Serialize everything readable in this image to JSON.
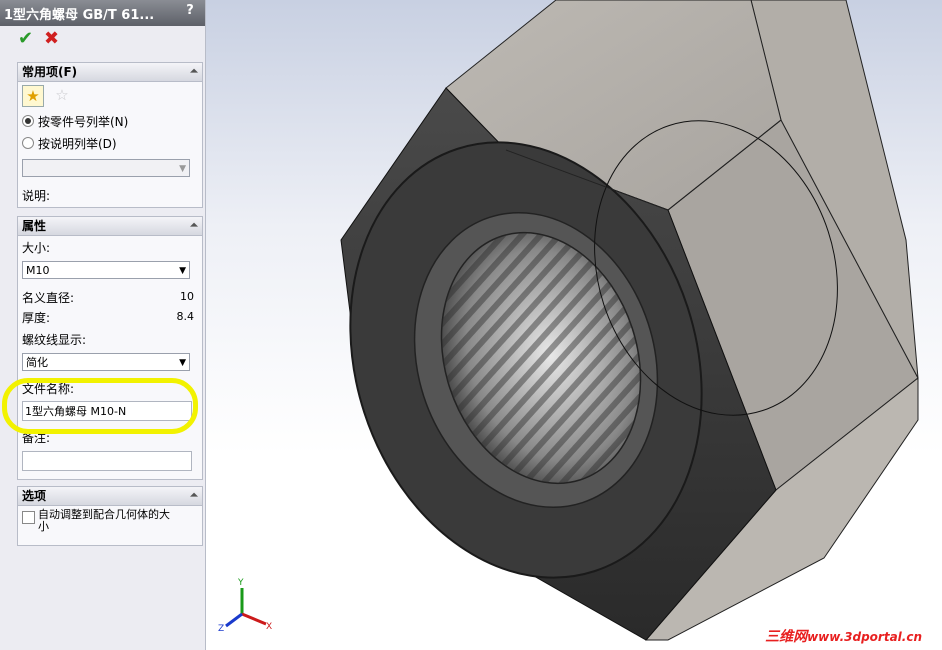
{
  "window": {
    "title": "1型六角螺母 GB/T 61...",
    "help_label": "?"
  },
  "actions": {
    "confirm_icon": "check-icon",
    "cancel_icon": "x-icon"
  },
  "common": {
    "header": "常用项(F)",
    "add_favorite_icon": "star-add-icon",
    "remove_favorite_icon": "star-remove-icon",
    "radio_by_part": "按零件号列举(N)",
    "radio_by_desc": "按说明列举(D)",
    "description_label": "说明:"
  },
  "properties": {
    "header": "属性",
    "size_label": "大小:",
    "size_value": "M10",
    "nominal_diameter_label": "名义直径:",
    "nominal_diameter_value": "10",
    "thickness_label": "厚度:",
    "thickness_value": "8.4",
    "thread_display_label": "螺纹线显示:",
    "thread_display_value": "简化",
    "filename_label": "文件名称:",
    "filename_value": "1型六角螺母 M10-N",
    "notes_label": "备注:",
    "notes_value": ""
  },
  "options": {
    "header": "选项",
    "auto_size_label_line1": "自动调整到配合几何体的大",
    "auto_size_label_line2": "小"
  },
  "triad": {
    "x": "X",
    "y": "Y",
    "z": "Z"
  },
  "watermark": {
    "cn": "三维网",
    "site": "www.3dportal.cn"
  },
  "colors": {
    "highlight": "#f2f200",
    "confirm": "#2a9a2a",
    "cancel": "#d02020"
  }
}
